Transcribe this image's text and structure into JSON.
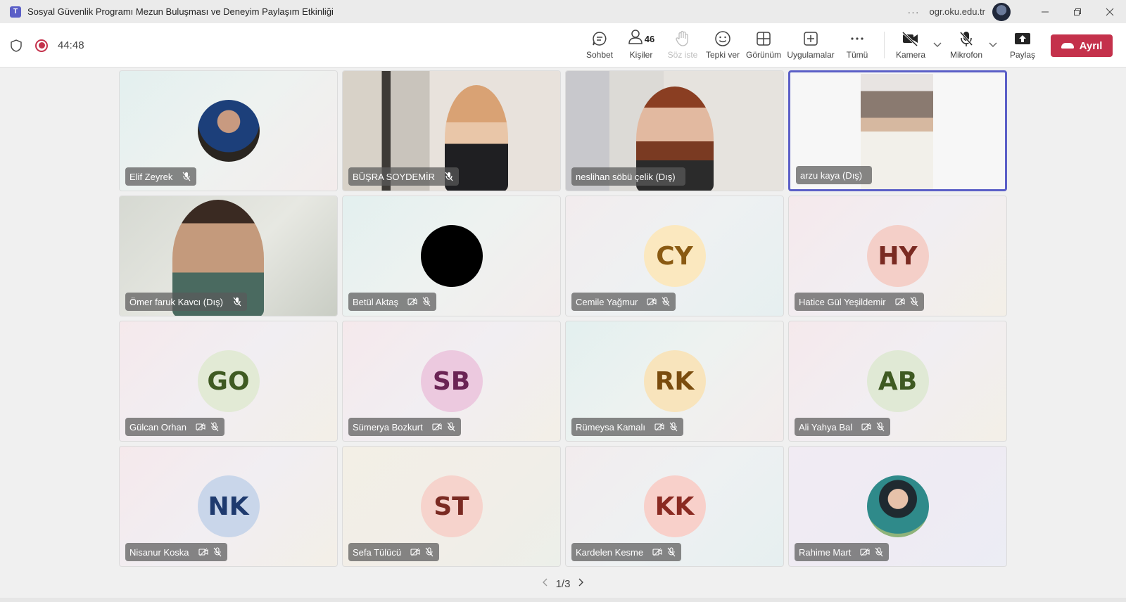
{
  "window": {
    "title": "Sosyal Güvenlik Programı Mezun Buluşması ve Deneyim Paylaşım Etkinliği",
    "account": "ogr.oku.edu.tr",
    "more": "···"
  },
  "meeting": {
    "timer": "44:48"
  },
  "toolbar": {
    "chat": "Sohbet",
    "people": "Kişiler",
    "people_count": "46",
    "raise_hand": "Söz iste",
    "react": "Tepki ver",
    "view": "Görünüm",
    "apps": "Uygulamalar",
    "more": "Tümü",
    "camera": "Kamera",
    "mic": "Mikrofon",
    "share": "Paylaş",
    "leave": "Ayrıl"
  },
  "participants": [
    {
      "name": "Elif Zeyrek",
      "initials": "",
      "type": "photo"
    },
    {
      "name": "BÜŞRA SOYDEMİR",
      "initials": "",
      "type": "video"
    },
    {
      "name": "neslihan söbü çelik (Dış)",
      "initials": "",
      "type": "video"
    },
    {
      "name": "arzu kaya (Dış)",
      "initials": "",
      "type": "video",
      "active": true
    },
    {
      "name": "Ömer faruk Kavcı (Dış)",
      "initials": "",
      "type": "video"
    },
    {
      "name": "Betül Aktaş",
      "initials": "",
      "type": "photo"
    },
    {
      "name": "Cemile Yağmur",
      "initials": "CY",
      "color": "#8a5a12",
      "bg": "#fbe8bf"
    },
    {
      "name": "Hatice Gül Yeşildemir",
      "initials": "HY",
      "color": "#7a2a22",
      "bg": "#f4cfc8"
    },
    {
      "name": "Gülcan Orhan",
      "initials": "GO",
      "color": "#3f5a22",
      "bg": "#e2ead5"
    },
    {
      "name": "Sümerya Bozkurt",
      "initials": "SB",
      "color": "#6b2455",
      "bg": "#ecc9df"
    },
    {
      "name": "Rümeysa Kamalı",
      "initials": "RK",
      "color": "#7a4c0e",
      "bg": "#f8e4bc"
    },
    {
      "name": "Ali Yahya Bal",
      "initials": "AB",
      "color": "#3f5a22",
      "bg": "#e0e9d5"
    },
    {
      "name": "Nisanur Koska",
      "initials": "NK",
      "color": "#1e3a6e",
      "bg": "#c9d6ea"
    },
    {
      "name": "Sefa Tülücü",
      "initials": "ST",
      "color": "#7a2a22",
      "bg": "#f6d3cc"
    },
    {
      "name": "Kardelen Kesme",
      "initials": "KK",
      "color": "#8a2a22",
      "bg": "#f8d0ca"
    },
    {
      "name": "Rahime Mart",
      "initials": "",
      "type": "photo"
    }
  ],
  "pager": {
    "label": "1/3"
  }
}
